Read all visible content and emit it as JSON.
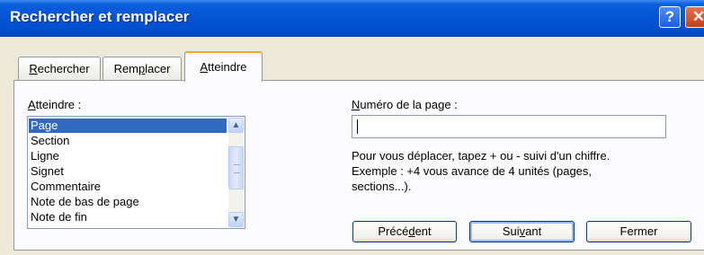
{
  "window": {
    "title": "Rechercher et remplacer",
    "help_glyph": "?",
    "close_glyph": "✕"
  },
  "tabs": [
    {
      "pre": "",
      "key": "R",
      "post": "echercher",
      "active": false
    },
    {
      "pre": "Rem",
      "key": "p",
      "post": "lacer",
      "active": false
    },
    {
      "pre": "",
      "key": "A",
      "post": "tteindre",
      "active": true
    }
  ],
  "goto": {
    "label_key": "A",
    "label_rest": "tteindre :",
    "items": [
      "Page",
      "Section",
      "Ligne",
      "Signet",
      "Commentaire",
      "Note de bas de page",
      "Note de fin"
    ],
    "selected_index": 0,
    "scroll_up_glyph": "▲",
    "scroll_down_glyph": "▼"
  },
  "page_number": {
    "label_key": "N",
    "label_rest": "uméro de la page :",
    "value": ""
  },
  "help": {
    "lines": [
      "Pour vous déplacer, tapez + ou - suivi d'un chiffre.",
      "Exemple : +4 vous avance de 4 unités (pages,",
      "sections...)."
    ]
  },
  "buttons": {
    "previous": {
      "pre": "Précé",
      "key": "d",
      "post": "ent"
    },
    "next": {
      "pre": "Sui",
      "key": "v",
      "post": "ant"
    },
    "close": {
      "pre": "",
      "key": "",
      "post": "Fermer"
    }
  }
}
